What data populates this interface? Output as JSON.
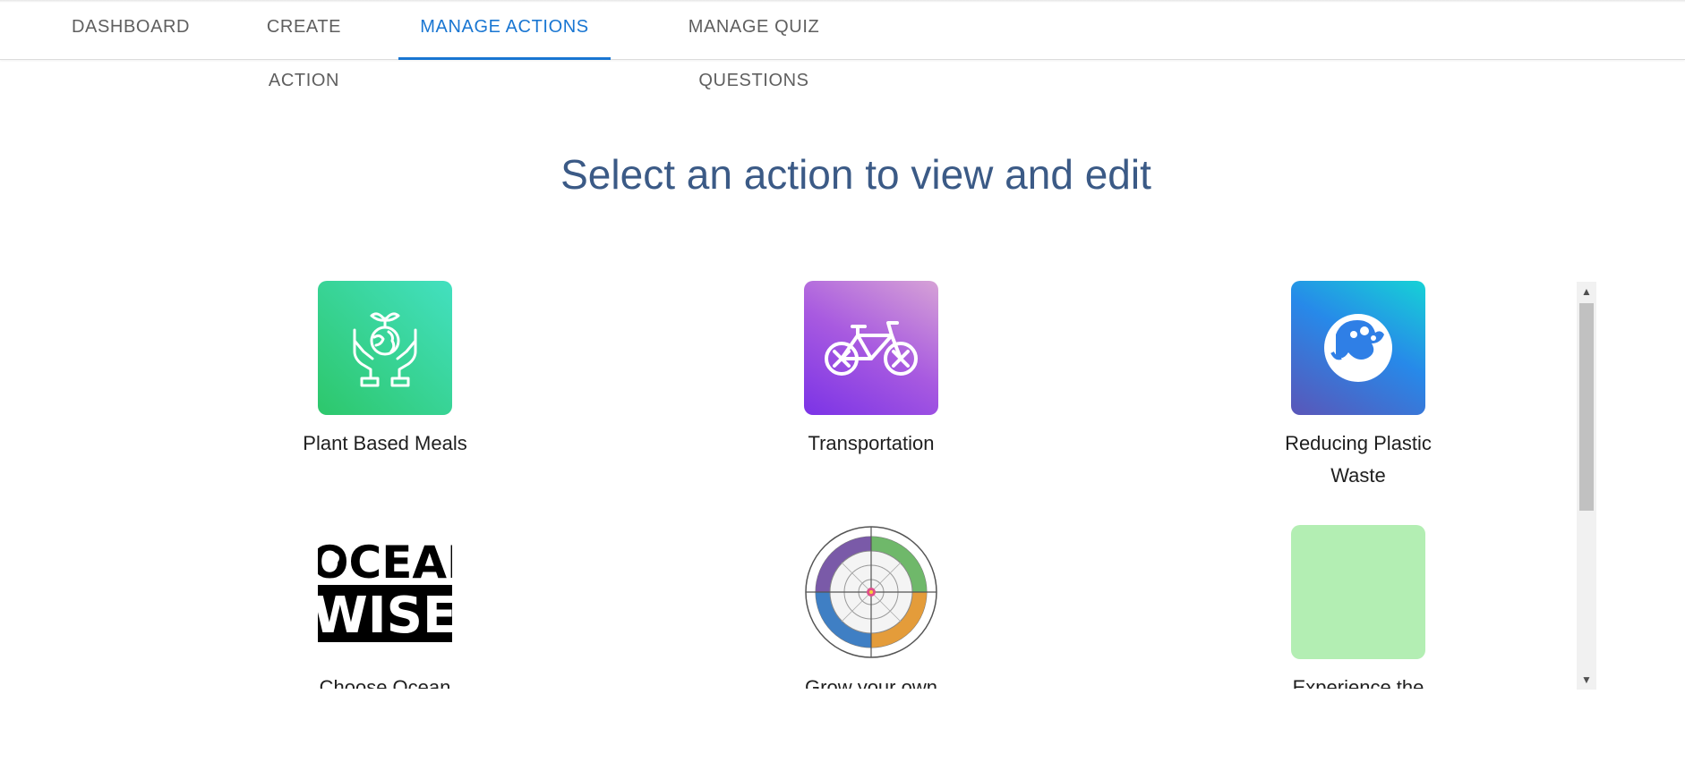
{
  "nav": {
    "tabs": [
      {
        "label": "DASHBOARD"
      },
      {
        "label": "CREATE ACTION"
      },
      {
        "label": "MANAGE ACTIONS",
        "active": true
      },
      {
        "label": "MANAGE QUIZ QUESTIONS"
      }
    ],
    "active_color": "#1976d2"
  },
  "page": {
    "title": "Select an action to view and edit"
  },
  "actions": [
    {
      "label": "Plant Based Meals",
      "icon": "hands-holding-globe-sprout-icon"
    },
    {
      "label": "Transportation",
      "icon": "bicycle-icon"
    },
    {
      "label": "Reducing Plastic Waste",
      "icon": "ocean-wave-icon"
    },
    {
      "label": "Choose Ocean",
      "icon": "ocean-wise-logo",
      "logo_text": [
        "OCEAN",
        "WISE"
      ]
    },
    {
      "label": "Grow your own",
      "icon": "seasonal-wheel-image"
    },
    {
      "label": "Experience the",
      "icon": "blank-green-tile"
    }
  ],
  "scrollbar": {
    "up_icon": "arrow-up-icon",
    "down_icon": "arrow-down-icon"
  }
}
